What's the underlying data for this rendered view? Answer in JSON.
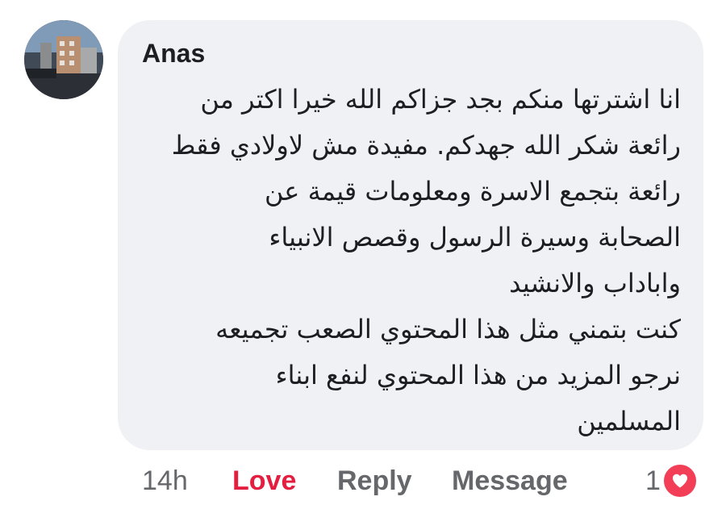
{
  "comment": {
    "author": "Anas",
    "lines": [
      "انا اشترتها منكم بجد جزاكم الله خيرا اكتر من",
      "رائعة شكر الله جهدكم. مفيدة مش لاولادي فقط",
      "رائعة بتجمع الاسرة ومعلومات قيمة عن",
      "الصحابة وسيرة الرسول وقصص الانبياء",
      "واباداب والانشيد",
      "كنت بتمني مثل هذا المحتوي الصعب تجميعه",
      "نرجو المزيد من هذا المحتوي لنفع ابناء",
      "المسلمين"
    ]
  },
  "actions": {
    "timestamp": "14h",
    "love_label": "Love",
    "reply_label": "Reply",
    "message_label": "Message"
  },
  "reactions": {
    "count": "1",
    "icon": "heart-icon",
    "color": "#f33e58"
  },
  "colors": {
    "bubble": "#eff1f4",
    "love_accent": "#e41e3f",
    "muted_text": "#65676b"
  }
}
